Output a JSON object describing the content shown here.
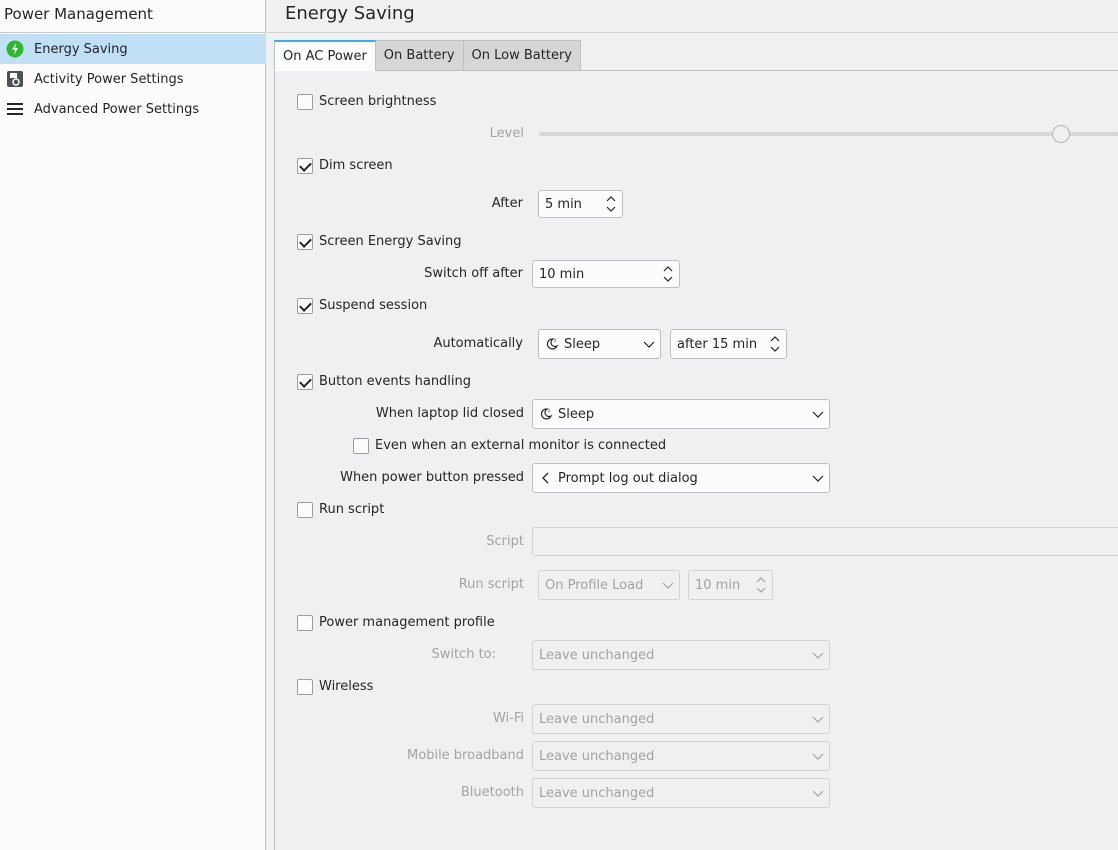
{
  "sidebar": {
    "title": "Power Management",
    "items": [
      {
        "label": "Energy Saving",
        "icon": "energy-icon"
      },
      {
        "label": "Activity Power Settings",
        "icon": "activity-icon"
      },
      {
        "label": "Advanced Power Settings",
        "icon": "menu-icon"
      }
    ]
  },
  "header": {
    "title": "Energy Saving"
  },
  "tabs": [
    {
      "label": "On AC Power"
    },
    {
      "label": "On Battery"
    },
    {
      "label": "On Low Battery"
    }
  ],
  "settings": {
    "screen_brightness": {
      "label": "Screen brightness",
      "checked": false,
      "level_label": "Level",
      "level": 0.9
    },
    "dim_screen": {
      "label": "Dim screen",
      "checked": true,
      "after_label": "After",
      "after_value": "5 min"
    },
    "screen_energy": {
      "label": "Screen Energy Saving",
      "checked": true,
      "switch_label": "Switch off after",
      "switch_value": "10 min"
    },
    "suspend": {
      "label": "Suspend session",
      "checked": true,
      "auto_label": "Automatically",
      "action": "Sleep",
      "after_value": "after 15 min"
    },
    "buttons": {
      "label": "Button events handling",
      "checked": true,
      "lid_label": "When laptop lid closed",
      "lid_value": "Sleep",
      "external_label": "Even when an external monitor is connected",
      "external_checked": false,
      "power_label": "When power button pressed",
      "power_value": "Prompt log out dialog"
    },
    "run_script": {
      "label": "Run script",
      "checked": false,
      "script_label": "Script",
      "run_label": "Run script",
      "run_value": "On Profile Load",
      "time_value": "10 min"
    },
    "profile": {
      "label": "Power management profile",
      "checked": false,
      "switch_label": "Switch to:",
      "switch_value": "Leave unchanged"
    },
    "wireless": {
      "label": "Wireless",
      "checked": false,
      "wifi_label": "Wi-Fi",
      "wifi_value": "Leave unchanged",
      "mobile_label": "Mobile broadband",
      "mobile_value": "Leave unchanged",
      "bt_label": "Bluetooth",
      "bt_value": "Leave unchanged"
    }
  },
  "colors": {
    "accent": "#3daee9",
    "selection": "#c2e0f5",
    "energy_icon": "#2eb82e"
  }
}
